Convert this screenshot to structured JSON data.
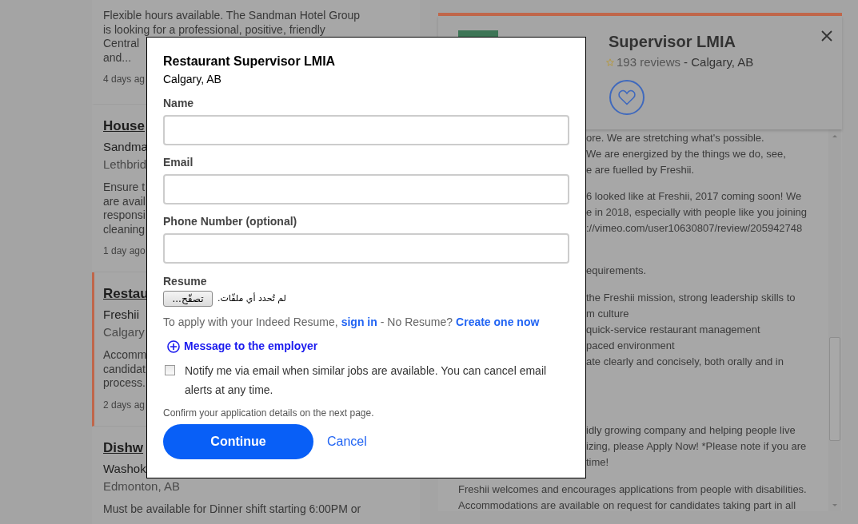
{
  "job_list": {
    "cards": [
      {
        "snippet": [
          "Flexible hours available. The Sandman Hotel Group",
          "is looking for a professional, positive, friendly",
          "Central",
          "and..."
        ],
        "age": "4 days ag",
        "selected": false
      },
      {
        "title": "House",
        "company": "Sandma",
        "location": "Lethbrid",
        "snippet": [
          "Ensure t",
          "are avail",
          "responsi",
          "cleaning"
        ],
        "age": "1 day ago",
        "selected": false
      },
      {
        "title": "Restau",
        "company": "Freshii",
        "location": "Calgary",
        "snippet": [
          "Accomm",
          "candidat",
          "process."
        ],
        "age": "2 days ag",
        "selected": true
      },
      {
        "title": "Dishw",
        "company": "Washok",
        "location": "Edmonton, AB",
        "snippet": [
          "Must be available for Dinner shift starting 6:00PM or"
        ],
        "selected": false
      }
    ]
  },
  "detail": {
    "title": "Supervisor LMIA",
    "reviews": "193 reviews",
    "location": "- Calgary, AB",
    "paragraphs": [
      {
        "kind": "cut",
        "lines": [
          "ore. We are stretching what's possible.",
          "We are energized by the things we do, see,",
          "e are fuelled by Freshii."
        ]
      },
      {
        "kind": "cut",
        "lines": [
          "6 looked like at Freshii, 2017 coming soon! We",
          "e in 2018, especially with people like you joining",
          "://vimeo.com/user10630807/review/205942748"
        ]
      },
      {
        "kind": "cut",
        "lines": [
          "equirements."
        ]
      },
      {
        "kind": "cut",
        "lines": [
          "the Freshii mission, strong leadership skills to",
          "m culture",
          "quick-service restaurant management",
          "paced environment",
          "ate clearly and concisely, both orally and in"
        ]
      },
      {
        "kind": "cut",
        "lines": [
          "idly growing company and helping people live",
          "izing, please Apply Now! *Please note if you are",
          "time!"
        ]
      },
      {
        "kind": "full",
        "lines": [
          "Freshii welcomes and encourages applications from people with disabilities.",
          "Accommodations are available on request for candidates taking part in all"
        ]
      }
    ]
  },
  "modal": {
    "title": "Restaurant Supervisor LMIA",
    "location": "Calgary, AB",
    "fields": [
      {
        "label": "Name"
      },
      {
        "label": "Email"
      },
      {
        "label": "Phone Number (optional)"
      }
    ],
    "resume": {
      "label": "Resume",
      "button": "تصفّح...",
      "status": "لم تُحدد أي ملفّات."
    },
    "apply_note": {
      "prefix": "To apply with your Indeed Resume,",
      "sign_in": "sign in",
      "middle": "- No Resume?",
      "create": "Create one now"
    },
    "message_link": "Message to the employer",
    "notify": {
      "checked": false,
      "text": "Notify me via email when similar jobs are available. You can cancel email alerts at any time."
    },
    "confirm_note": "Confirm your application details on the next page.",
    "continue": "Continue",
    "cancel": "Cancel"
  }
}
